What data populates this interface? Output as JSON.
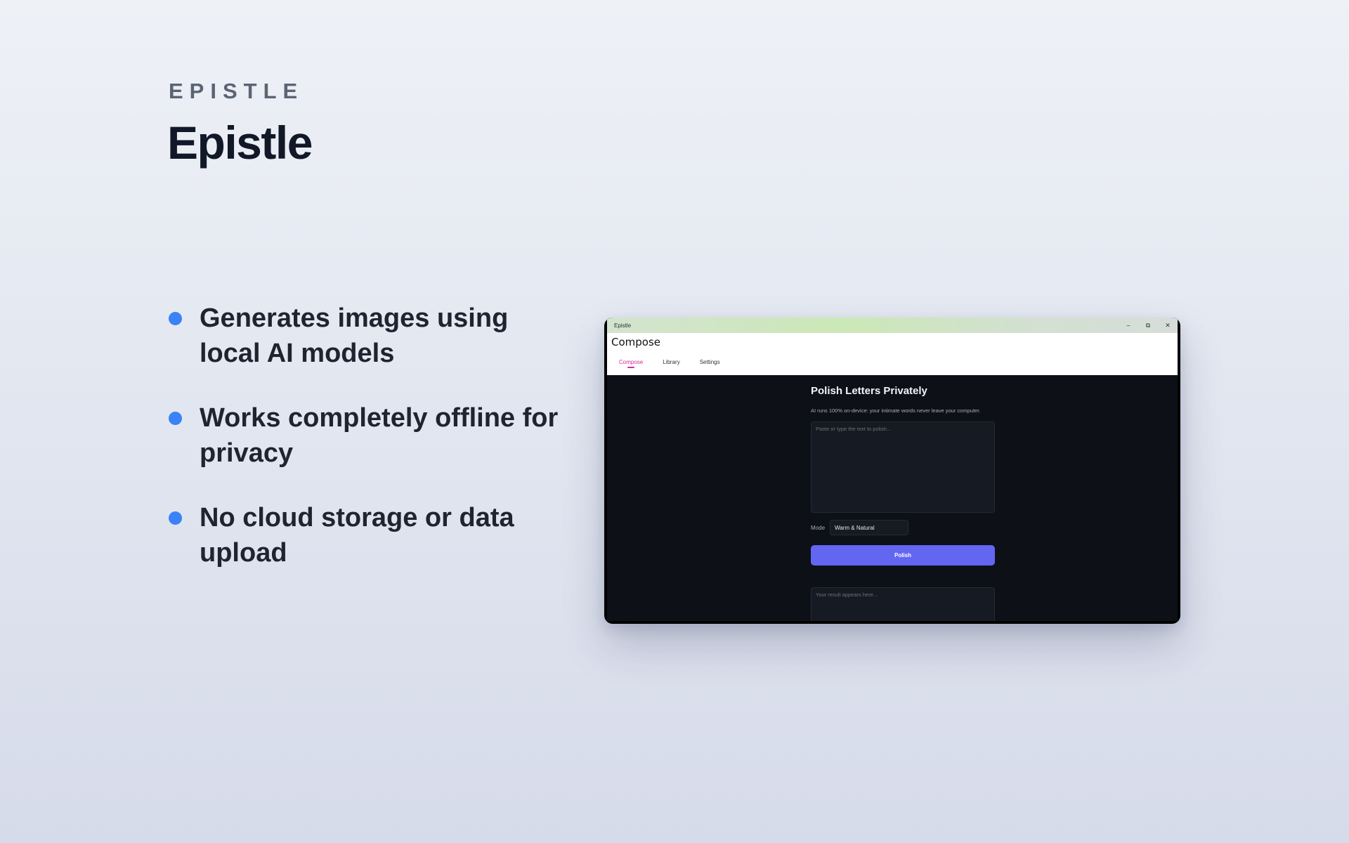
{
  "hero": {
    "eyebrow": "EPISTLE",
    "headline": "Epistle"
  },
  "features": [
    "Generates images using local AI models",
    "Works completely offline for privacy",
    "No cloud storage or data upload"
  ],
  "colors": {
    "bullet": "#3b82f6",
    "accent_tab": "#d6289a",
    "primary_button": "#6366f1",
    "app_background": "#0d1017"
  },
  "app": {
    "window_title": "Epistle",
    "window_controls": {
      "minimize": "–",
      "restore": "⧉",
      "close": "✕"
    },
    "page_title": "Compose",
    "tabs": [
      {
        "label": "Compose",
        "active": true
      },
      {
        "label": "Library",
        "active": false
      },
      {
        "label": "Settings",
        "active": false
      }
    ],
    "compose": {
      "title": "Polish Letters Privately",
      "subtitle": "AI runs 100% on-device: your intimate words never leave your computer.",
      "input_placeholder": "Paste or type the text to polish...",
      "mode_label": "Mode",
      "mode_value": "Warm & Natural",
      "polish_button": "Polish",
      "output_placeholder": "Your result appears here..."
    }
  }
}
